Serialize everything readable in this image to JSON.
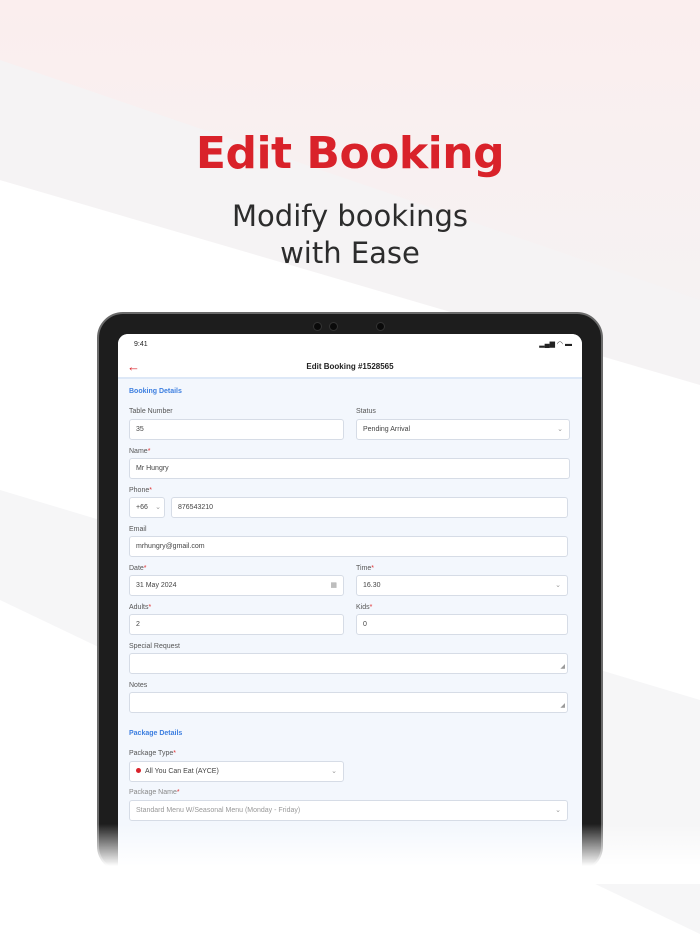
{
  "promo": {
    "title": "Edit Booking",
    "subtitle_line1": "Modify bookings",
    "subtitle_line2": "with Ease"
  },
  "status_bar": {
    "time": "9:41"
  },
  "nav": {
    "title": "Edit Booking #1528565"
  },
  "booking_details": {
    "section": "Booking Details",
    "table_number": {
      "label": "Table Number",
      "value": "35"
    },
    "status": {
      "label": "Status",
      "value": "Pending Arrival"
    },
    "name": {
      "label": "Name",
      "value": "Mr Hungry"
    },
    "phone": {
      "label": "Phone",
      "code": "+66",
      "value": "876543210"
    },
    "email": {
      "label": "Email",
      "value": "mrhungry@gmail.com"
    },
    "date": {
      "label": "Date",
      "value": "31 May 2024"
    },
    "time": {
      "label": "Time",
      "value": "16.30"
    },
    "adults": {
      "label": "Adults",
      "value": "2"
    },
    "kids": {
      "label": "Kids",
      "value": "0"
    },
    "special_request": {
      "label": "Special Request",
      "value": ""
    },
    "notes": {
      "label": "Notes",
      "value": ""
    }
  },
  "package_details": {
    "section": "Package Details",
    "package_type": {
      "label": "Package Type",
      "value": "All You Can Eat (AYCE)"
    },
    "package_name": {
      "label": "Package Name",
      "value": "Standard Menu W/Seasonal Menu (Monday - Friday)"
    }
  },
  "required_mark": "*",
  "colors": {
    "accent": "#d9222a",
    "section": "#3d7fe0"
  }
}
